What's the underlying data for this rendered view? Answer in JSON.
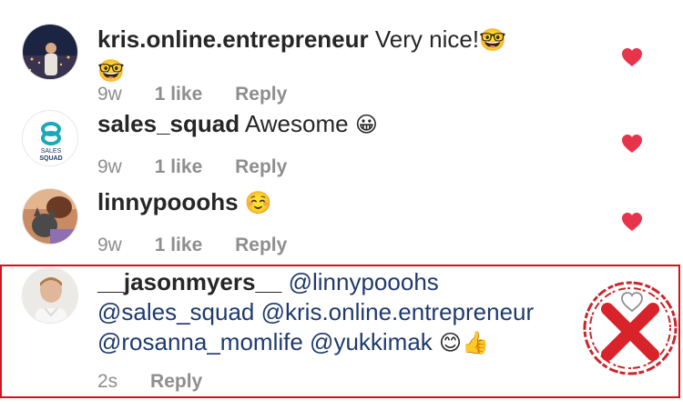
{
  "comments": [
    {
      "username": "kris.online.entrepreneur",
      "text": "Very nice!",
      "emoji_inline": "🤓",
      "emoji_second_line": "🤓",
      "time": "9w",
      "likes": "1 like",
      "reply": "Reply",
      "avatar_icon": "city-night-person-avatar",
      "liked": true
    },
    {
      "username": "sales_squad",
      "text": "Awesome",
      "emoji_inline": "😀",
      "time": "9w",
      "likes": "1 like",
      "reply": "Reply",
      "avatar_icon": "sales-squad-logo-avatar",
      "avatar_logo_line1": "SALES",
      "avatar_logo_line2": "SQUAD",
      "liked": true
    },
    {
      "username": "linnypooohs",
      "text": "",
      "emoji_inline": "☺️",
      "time": "9w",
      "likes": "1 like",
      "reply": "Reply",
      "avatar_icon": "person-with-cat-avatar",
      "liked": true
    },
    {
      "username": "__jasonmyers__",
      "mentions_line1": "@linnypooohs",
      "mentions_line2": "@sales_squad @kris.online.entrepreneur",
      "mentions_line3": "@rosanna_momlife @yukkimak",
      "emoji_end": "😊👍",
      "time": "2s",
      "reply": "Reply",
      "avatar_icon": "man-portrait-avatar",
      "liked": false
    }
  ],
  "colors": {
    "heart_liked": "#e8344a",
    "heart_unliked": "#8e8e8e",
    "highlight_border": "#d0141d",
    "x_mark": "#d8232a",
    "mention": "#1f3a6e",
    "meta": "#8e8e8e"
  },
  "overlay": {
    "icon": "red-x-circle-stamp-icon"
  }
}
